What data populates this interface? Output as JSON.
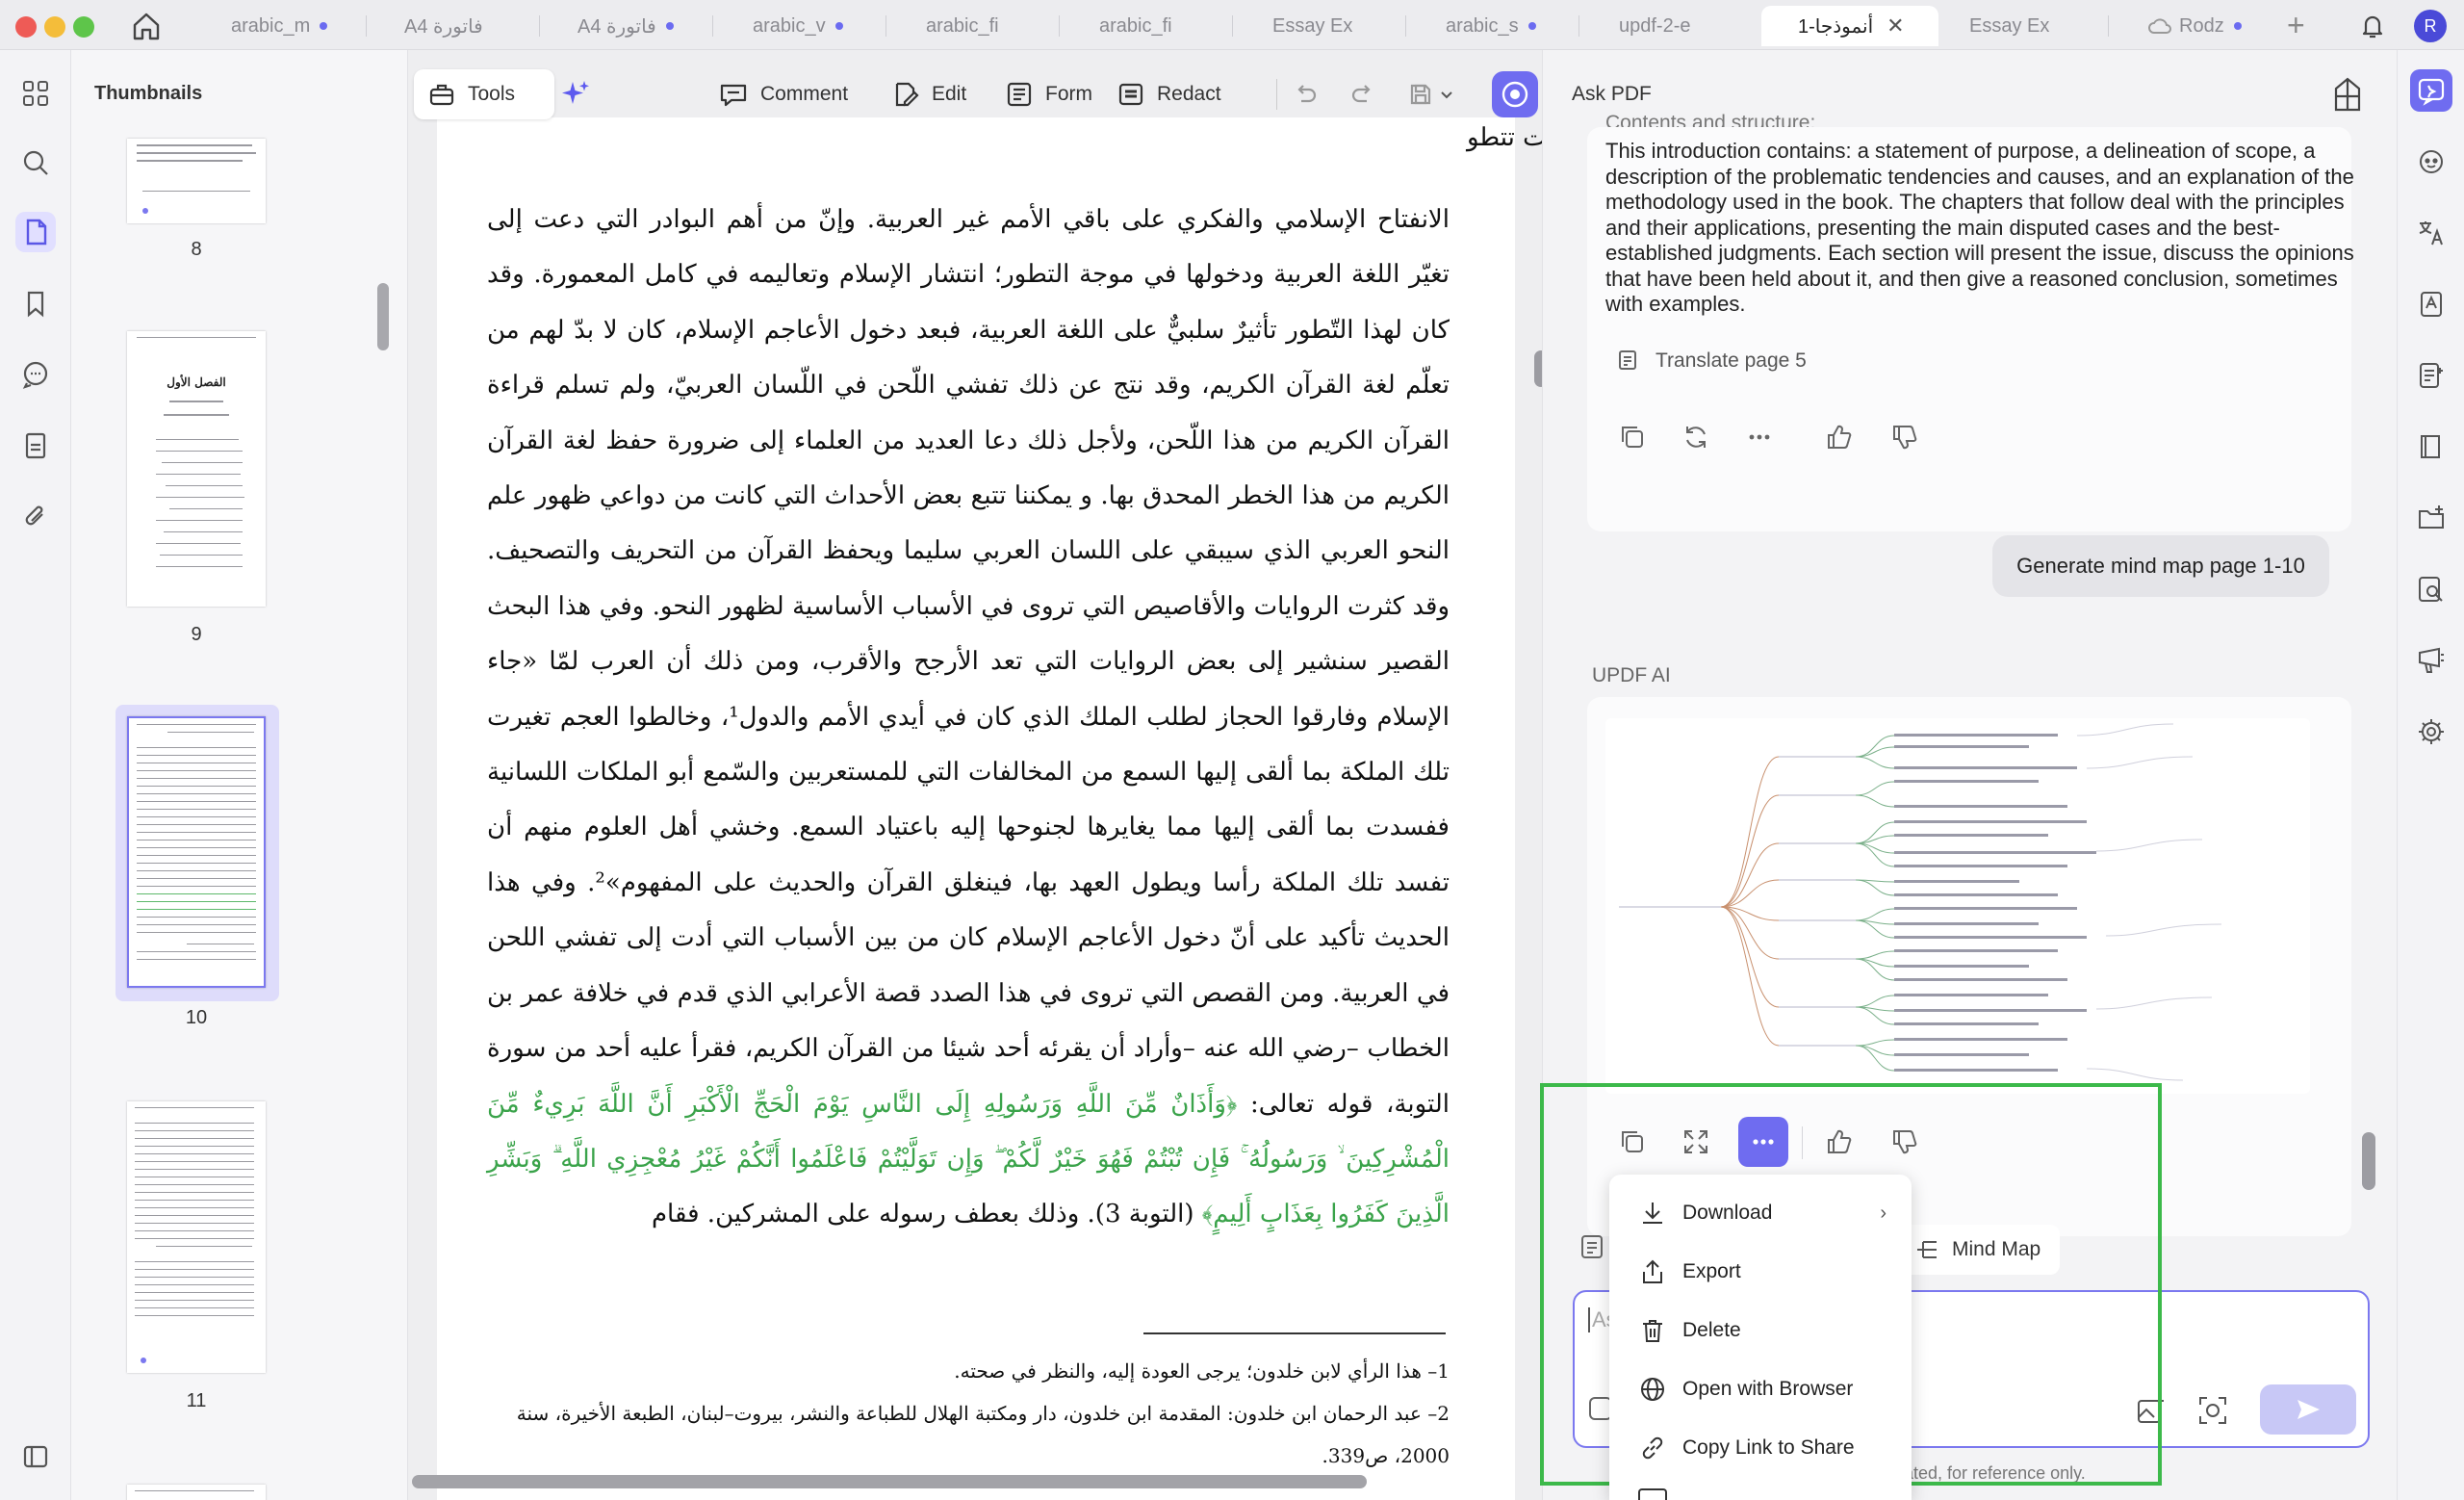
{
  "tabs": [
    {
      "label": "arabic_m",
      "dot": true
    },
    {
      "label": "A4 فاتورة",
      "dot": false
    },
    {
      "label": "A4 فاتورة",
      "dot": true
    },
    {
      "label": "arabic_v",
      "dot": true
    },
    {
      "label": "arabic_fi",
      "dot": false
    },
    {
      "label": "arabic_fi",
      "dot": false
    },
    {
      "label": "Essay Ex",
      "dot": false
    },
    {
      "label": "arabic_s",
      "dot": true
    },
    {
      "label": "updf-2-e",
      "dot": false
    },
    {
      "label": "أنموذجا-1",
      "dot": false
    },
    {
      "label": "Essay Ex",
      "dot": false
    },
    {
      "label": "Rodz",
      "dot": true
    }
  ],
  "user_avatar": "R",
  "thumbnails": {
    "title": "Thumbnails",
    "pages": [
      "8",
      "9",
      "10",
      "11"
    ],
    "page9_heading": "الفصل الأول"
  },
  "toolbar": {
    "tools": "Tools",
    "comment": "Comment",
    "edit": "Edit",
    "form": "Form",
    "redact": "Redact",
    "page_title_fragment": "ت تتطو"
  },
  "document": {
    "body_text": "الانفتاح الإسلامي والفكري على باقي الأمم غير العربية. وإنّ من أهم البوادر التي دعت إلى تغيّر اللغة العربية ودخولها في موجة التطور؛ انتشار الإسلام وتعاليمه في كامل المعمورة. وقد كان لهذا التّطور تأثيرٌ سلبيٌّ على اللغة العربية، فبعد دخول الأعاجم الإسلام، كان لا بدّ لهم من تعلّم لغة القرآن الكريم، وقد نتج عن ذلك تفشي اللّحن في اللّسان العربيّ، ولم تسلم قراءة القرآن الكريم من هذا اللّحن، ولأجل ذلك دعا العديد من العلماء إلى ضرورة حفظ لغة القرآن الكريم من هذا الخطر المحدق بها. و يمكننا تتبع بعض الأحداث التي كانت من دواعي ظهور علم النحو العربي الذي سيبقي على اللسان العربي سليما ويحفظ القرآن من التحريف والتصحيف. وقد كثرت الروايات والأقاصيص التي تروى في الأسباب الأساسية لظهور النحو. وفي هذا البحث القصير سنشير إلى بعض الروايات التي تعد الأرجح والأقرب، ومن ذلك أن العرب لمّا «جاء الإسلام وفارقوا الحجاز لطلب الملك الذي كان في أيدي الأمم والدول¹، وخالطوا العجم تغيرت تلك الملكة بما ألقى إليها السمع من المخالفات التي للمستعربين والسّمع أبو الملكات اللسانية ففسدت بما ألقى إليها مما يغايرها لجنوحها إليه باعتياد السمع. وخشي أهل العلوم منهم أن تفسد تلك الملكة رأسا ويطول العهد بها، فينغلق القرآن والحديث على المفهوم»². وفي هذا الحديث تأكيد على أنّ دخول الأعاجم الإسلام كان من بين الأسباب التي أدت إلى تفشي اللحن في العربية. ومن القصص التي تروى في هذا الصدد قصة الأعرابي الذي قدم في خلافة عمر بن الخطاب –رضي الله عنه –وأراد أن يقرئه أحد شيئا من القرآن الكريم، فقرأ عليه أحد من سورة التوبة، قوله تعالى: ",
    "quran_text": "﴿وَأَذَانٌ مِّنَ اللَّهِ وَرَسُولِهِ إِلَى النَّاسِ يَوْمَ الْحَجِّ الْأَكْبَرِ أَنَّ اللَّهَ بَرِيءٌ مِّنَ الْمُشْرِكِينَ ۙ وَرَسُولُهُ ۚ فَإِن تُبْتُمْ فَهُوَ خَيْرٌ لَّكُمْ ۖ وَإِن تَوَلَّيْتُمْ فَاعْلَمُوا أَنَّكُمْ غَيْرُ مُعْجِزِي اللَّهِ ۗ وَبَشِّرِ الَّذِينَ كَفَرُوا بِعَذَابٍ أَلِيمٍ﴾",
    "after_quran": " (التوبة 3). وذلك بعطف رسوله على المشركين. فقام",
    "footnote1": "1– هذا الرأي لابن خلدون؛ يرجى العودة إليه، والنظر في صحته.",
    "footnote2": "2– عبد الرحمان ابن خلدون: المقدمة ابن خلدون، دار ومكتبة الهلال للطباعة والنشر، بيروت–لبنان، الطبعة الأخيرة، سنة 2000، ص339."
  },
  "ask_pdf": {
    "title": "Ask PDF",
    "cut_text": "Contents and structure:",
    "answer_text": "This introduction contains: a statement of purpose, a delineation of scope, a description of the problematic tendencies and causes, and an explanation of the methodology used in the book. The chapters that follow deal with the principles and their applications, presenting the main disputed cases and the best-established judgments. Each section will present the issue, discuss the opinions that have been held about it, and then give a reasoned conclusion, sometimes with examples.",
    "translate_label": "Translate page 5",
    "user_message": "Generate mind map page 1-10",
    "ai_label": "UPDF AI",
    "mind_map_chip": "Mind Map",
    "input_placeholder": "As",
    "disclaimer": "ated, for reference only."
  },
  "context_menu": {
    "items": [
      "Download",
      "Export",
      "Delete",
      "Open with Browser",
      "Copy Link to Share"
    ],
    "submenu_indicator": "›"
  },
  "colors": {
    "accent": "#6f6cf0",
    "highlight": "#3cb94a",
    "quran": "#3aa34a"
  }
}
